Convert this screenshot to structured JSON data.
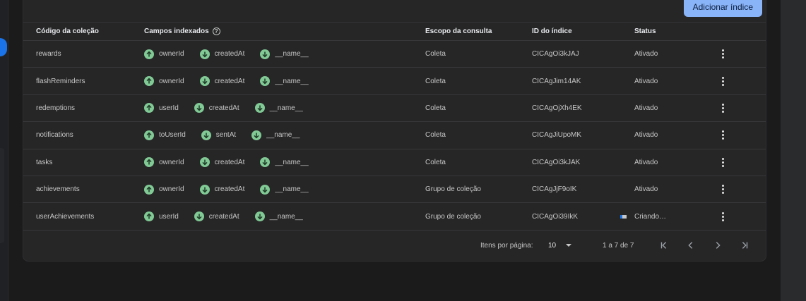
{
  "toolbar": {
    "add_label": "Adicionar índice"
  },
  "table": {
    "headers": {
      "collection": "Código da coleção",
      "fields": "Campos indexados",
      "scope": "Escopo da consulta",
      "index_id": "ID do índice",
      "status": "Status"
    },
    "rows": [
      {
        "collection": "rewards",
        "fields": [
          {
            "dir": "up",
            "name": "ownerId"
          },
          {
            "dir": "down",
            "name": "createdAt"
          },
          {
            "dir": "down",
            "name": "__name__"
          }
        ],
        "scope": "Coleta",
        "index_id": "CICAgOi3kJAJ",
        "status": "Ativado"
      },
      {
        "collection": "flashReminders",
        "fields": [
          {
            "dir": "up",
            "name": "ownerId"
          },
          {
            "dir": "down",
            "name": "createdAt"
          },
          {
            "dir": "down",
            "name": "__name__"
          }
        ],
        "scope": "Coleta",
        "index_id": "CICAgJim14AK",
        "status": "Ativado"
      },
      {
        "collection": "redemptions",
        "fields": [
          {
            "dir": "up",
            "name": "userId"
          },
          {
            "dir": "down",
            "name": "createdAt"
          },
          {
            "dir": "down",
            "name": "__name__"
          }
        ],
        "scope": "Coleta",
        "index_id": "CICAgOjXh4EK",
        "status": "Ativado"
      },
      {
        "collection": "notifications",
        "fields": [
          {
            "dir": "up",
            "name": "toUserId"
          },
          {
            "dir": "down",
            "name": "sentAt"
          },
          {
            "dir": "down",
            "name": "__name__"
          }
        ],
        "scope": "Coleta",
        "index_id": "CICAgJiUpoMK",
        "status": "Ativado"
      },
      {
        "collection": "tasks",
        "fields": [
          {
            "dir": "up",
            "name": "ownerId"
          },
          {
            "dir": "down",
            "name": "createdAt"
          },
          {
            "dir": "down",
            "name": "__name__"
          }
        ],
        "scope": "Coleta",
        "index_id": "CICAgOi3kJAK",
        "status": "Ativado"
      },
      {
        "collection": "achievements",
        "fields": [
          {
            "dir": "up",
            "name": "ownerId"
          },
          {
            "dir": "down",
            "name": "createdAt"
          },
          {
            "dir": "down",
            "name": "__name__"
          }
        ],
        "scope": "Grupo de coleção",
        "index_id": "CICAgJjF9oIK",
        "status": "Ativado"
      },
      {
        "collection": "userAchievements",
        "fields": [
          {
            "dir": "up",
            "name": "userId"
          },
          {
            "dir": "down",
            "name": "createdAt"
          },
          {
            "dir": "down",
            "name": "__name__"
          }
        ],
        "scope": "Grupo de coleção",
        "index_id": "CICAgOi39IkK",
        "status": "Criando…",
        "creating": true
      }
    ]
  },
  "pager": {
    "items_per_page_label": "Itens por página:",
    "page_size": "10",
    "range": "1 a 7 de 7"
  },
  "colors": {
    "accent": "#8ab4f8",
    "ascending": "#81c995",
    "progress": "#1a73e8"
  }
}
